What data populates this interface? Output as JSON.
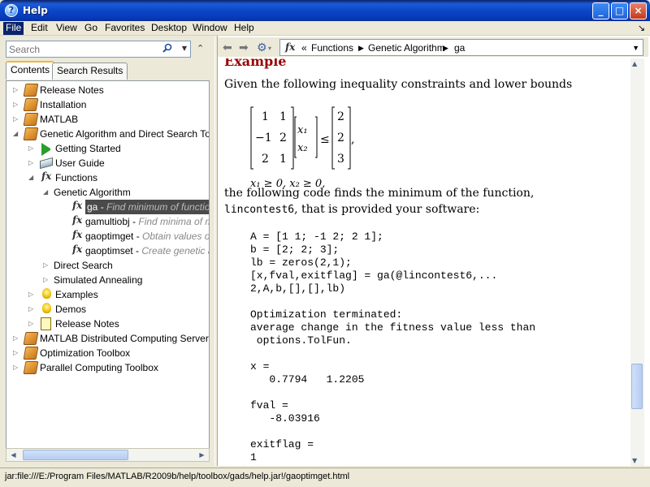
{
  "window": {
    "title": "Help",
    "min": "_",
    "max": "□",
    "close": "×"
  },
  "menu": [
    "File",
    "Edit",
    "View",
    "Go",
    "Favorites",
    "Desktop",
    "Window",
    "Help"
  ],
  "left": {
    "search_placeholder": "Search",
    "tabs": [
      "Contents",
      "Search Results"
    ],
    "tree": [
      {
        "label": "Release Notes",
        "icon": "book-icon"
      },
      {
        "label": "Installation",
        "icon": "book-icon"
      },
      {
        "label": "MATLAB",
        "icon": "book-icon"
      },
      {
        "label": "Genetic Algorithm and Direct Search Toolbox",
        "icon": "book-icon"
      },
      {
        "label": "Getting Started",
        "icon": "play-icon"
      },
      {
        "label": "User Guide",
        "icon": "guide-icon"
      },
      {
        "label": "Functions",
        "icon": "function-icon"
      },
      {
        "label": "Genetic Algorithm",
        "icon": ""
      },
      {
        "label": "ga",
        "desc": "Find minimum of function us",
        "icon": "function-icon"
      },
      {
        "label": "gamultiobj",
        "desc": "Find minima of multi",
        "icon": "function-icon"
      },
      {
        "label": "gaoptimget",
        "desc": "Obtain values of g",
        "icon": "function-icon"
      },
      {
        "label": "gaoptimset",
        "desc": "Create genetic alg",
        "icon": "function-icon"
      },
      {
        "label": "Direct Search",
        "icon": ""
      },
      {
        "label": "Simulated Annealing",
        "icon": ""
      },
      {
        "label": "Examples",
        "icon": "bulb-icon"
      },
      {
        "label": "Demos",
        "icon": "bulb-icon"
      },
      {
        "label": "Release Notes",
        "icon": "notes-icon"
      },
      {
        "label": "MATLAB Distributed Computing Server",
        "icon": "book-icon"
      },
      {
        "label": "Optimization Toolbox",
        "icon": "book-icon"
      },
      {
        "label": "Parallel Computing Toolbox",
        "icon": "book-icon"
      }
    ]
  },
  "breadcrumb": {
    "fx": "fx",
    "sep": "«",
    "items": [
      "Functions",
      "Genetic Algorithm",
      "ga"
    ]
  },
  "content": {
    "heading": "Example",
    "intro": "Given the following inequality constraints and lower bounds",
    "math": {
      "A": [
        [
          "1",
          "1"
        ],
        [
          "−1",
          "2"
        ],
        [
          "2",
          "1"
        ]
      ],
      "x": [
        "x₁",
        "x₂"
      ],
      "b": [
        "2",
        "2",
        "3"
      ],
      "leq": "≤",
      "bounds": "x₁ ≥ 0,  x₂ ≥ 0,"
    },
    "para2_a": "the following code finds the minimum of the function,",
    "para2_code": "lincontest6",
    "para2_b": ", that is provided your software:",
    "code_block": "A = [1 1; -1 2; 2 1];\nb = [2; 2; 3];\nlb = zeros(2,1);\n[x,fval,exitflag] = ga(@lincontest6,...\n2,A,b,[],[],lb)\n\nOptimization terminated:\naverage change in the fitness value less than\n options.TolFun.\n\nx =\n   0.7794   1.2205\n\nfval =\n   -8.03916\n\nexitflag =\n1"
  },
  "status": "jar:file:///E:/Program Files/MATLAB/R2009b/help/toolbox/gads/help.jar!/gaoptimget.html"
}
